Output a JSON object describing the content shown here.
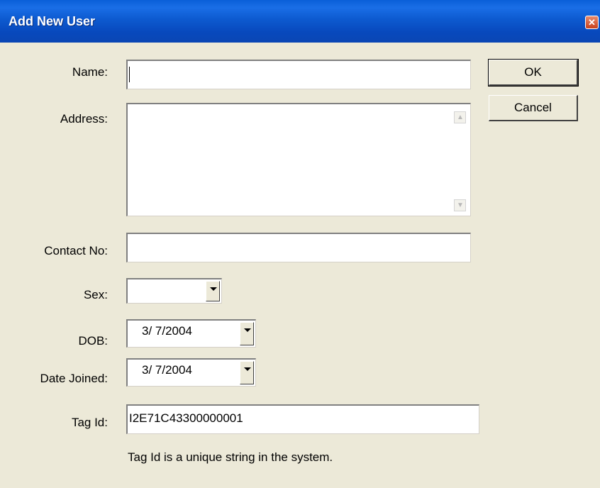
{
  "window": {
    "title": "Add New User"
  },
  "form": {
    "name": {
      "label": "Name:",
      "value": ""
    },
    "address": {
      "label": "Address:",
      "value": ""
    },
    "contact": {
      "label": "Contact No:",
      "value": ""
    },
    "sex": {
      "label": "Sex:",
      "value": ""
    },
    "dob": {
      "label": "DOB:",
      "value": "3/  7/2004"
    },
    "date_joined": {
      "label": "Date Joined:",
      "value": "3/  7/2004"
    },
    "tag_id": {
      "label": "Tag Id:",
      "value": "I2E71C43300000001",
      "hint": "Tag Id is a unique string in the system."
    }
  },
  "buttons": {
    "ok": "OK",
    "cancel": "Cancel"
  },
  "icons": {
    "close": "close-icon",
    "dropdown": "chevron-down-icon",
    "scroll_up": "scroll-up-arrow-icon",
    "scroll_down": "scroll-down-arrow-icon"
  }
}
